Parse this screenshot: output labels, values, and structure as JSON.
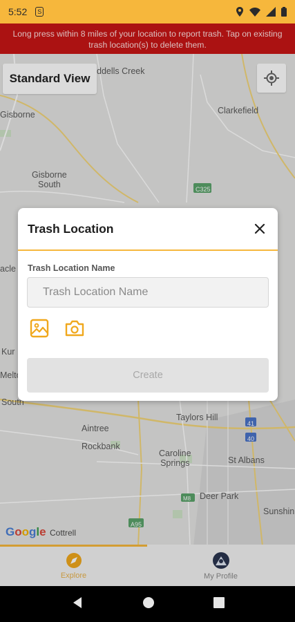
{
  "status_bar": {
    "time": "5:52",
    "icons": [
      "location-icon",
      "wifi-icon",
      "signal-icon",
      "battery-icon"
    ]
  },
  "banner": {
    "text": "Long press within 8 miles of your location to report trash. Tap on existing trash location(s) to delete them."
  },
  "map": {
    "view_button": "Standard View",
    "labels": {
      "riddells_creek": "ddells Creek",
      "gisborne": "Gisborne",
      "clarkefield": "Clarkefield",
      "gisborne_south": "Gisborne\nSouth",
      "c325": "C325",
      "kurunjang": "Kur",
      "melton": "Melto",
      "macleod": "acle",
      "south": "South",
      "taylors_hill": "Taylors Hill",
      "aintree": "Aintree",
      "rockbank": "Rockbank",
      "caroline_springs": "Caroline\nSprings",
      "st_albans": "St Albans",
      "deer_park": "Deer Park",
      "sunshine": "Sunshin",
      "cottrell": "Cottrell",
      "m41": "41",
      "m40": "40",
      "m8": "M8",
      "a95": "A95"
    },
    "attribution": "Google"
  },
  "modal": {
    "title": "Trash Location",
    "field_label": "Trash Location Name",
    "input_placeholder": "Trash Location Name",
    "input_value": "",
    "create_label": "Create"
  },
  "bottom_nav": {
    "tabs": [
      {
        "label": "Explore",
        "active": true
      },
      {
        "label": "My Profile",
        "active": false
      }
    ]
  },
  "colors": {
    "accent": "#f6b73c",
    "banner": "#c71515",
    "icon": "#f0a81d"
  }
}
